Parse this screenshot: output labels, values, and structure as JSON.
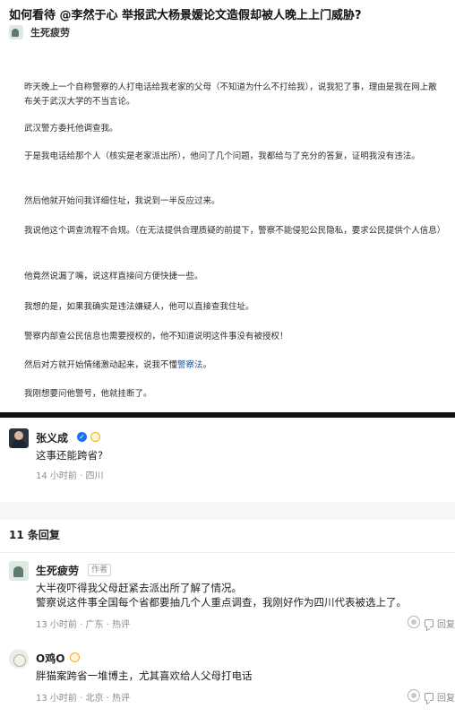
{
  "question": {
    "title": "如何看待 @李然于心 举报武大杨景媛论文造假却被人晚上上门威胁?"
  },
  "answer": {
    "author": "生死疲劳",
    "paragraphs": [
      "昨天晚上一个自称警察的人打电话给我老家的父母（不知道为什么不打给我），说我犯了事，理由是我在网上散布关于武汉大学的不当言论。",
      "武汉警方委托他调查我。",
      "于是我电话给那个人（核实是老家派出所），他问了几个问题，我都给与了充分的答复，证明我没有违法。",
      "然后他就开始问我详细住址，我说到一半反应过来。",
      "我说他这个调查流程不合规。（在无法提供合理质疑的前提下，警察不能侵犯公民隐私，要求公民提供个人信息）",
      "他竟然说漏了嘴，说这样直接问方便快捷一些。",
      "我想的是，如果我确实是违法嫌疑人，他可以直接查我住址。",
      "警察内部查公民信息也需要授权的，他不知道说明这件事没有被授权！",
      "然后对方就开始情绪激动起来，说我不懂",
      "我刚想要问他警号，他就挂断了。"
    ],
    "link_text": "警察法",
    "link_suffix": "。"
  },
  "comment": {
    "user": "张义成",
    "text": "这事还能跨省?",
    "time": "14 小时前",
    "location": "四川"
  },
  "replies": {
    "count_label": "11 条回复",
    "items": [
      {
        "user": "生死疲劳",
        "tag": "作者",
        "lines": [
          "大半夜吓得我父母赶紧去派出所了解了情况。",
          "警察说这件事全国每个省都要抽几个人重点调查，我刚好作为四川代表被选上了。"
        ],
        "time": "13 小时前",
        "location": "广东",
        "hot": "热评",
        "reply_label": "回复"
      },
      {
        "user": "O鸡O",
        "lines": [
          "胖猫案跨省一堆博主，尤其喜欢给人父母打电话"
        ],
        "time": "13 小时前",
        "location": "北京",
        "hot": "热评",
        "reply_label": "回复"
      }
    ]
  }
}
